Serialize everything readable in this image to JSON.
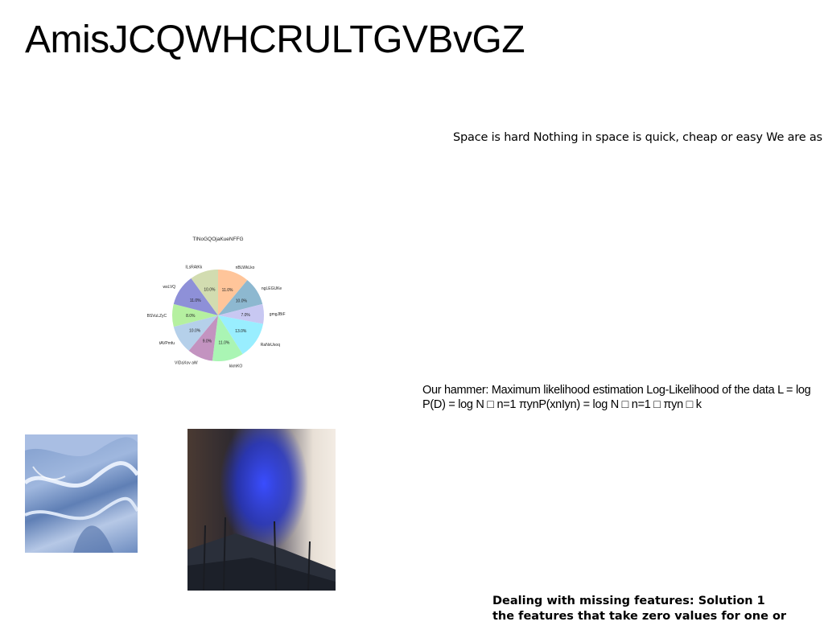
{
  "page": {
    "title": "AmisJCQWHCRULTGVBvGZ"
  },
  "texts": {
    "space": "Space is hard Nothing in space is quick, cheap or easy We are as",
    "hammer": "Our hammer: Maximum likelihood estimation Log-Likelihood of the data L = log P(D) = log N □ n=1 πynP(xnIyn) = log N □ n=1 □ πyn □ k",
    "missing_line1": "Dealing with missing features: Solution 1",
    "missing_line2": "the features that take zero values for one or"
  },
  "images": {
    "snow": "snow-dunes-photo",
    "fire": "blue-smoke-fire-photo"
  },
  "chart_data": {
    "type": "pie",
    "title": "TlNoGQOjaKueNFFG",
    "categories": [
      "nBLWkLko",
      "ngLEGUKe",
      "gmgJBiF",
      "RaNxUsoq",
      "kkmKO",
      "VIDaXov aW",
      "tAVPmfu",
      "BSVuLZyC",
      "wsLVQ",
      "ILsRAtKk"
    ],
    "values": [
      11.0,
      10.0,
      7.0,
      13.0,
      11.0,
      9.0,
      10.0,
      8.0,
      11.0,
      10.0
    ],
    "labels": [
      "11.0%",
      "10.0%",
      "7.0%",
      "13.0%",
      "11.0%",
      "9.0%",
      "10.0%",
      "8.0%",
      "11.0%",
      "10.0%"
    ],
    "colors": [
      "#ffc59a",
      "#8db8d0",
      "#c8c8f2",
      "#99eeff",
      "#aaf5b4",
      "#c393c0",
      "#b5d0ea",
      "#b5f0a0",
      "#8e90d8",
      "#d2dcb0"
    ],
    "start_angle_deg": 90,
    "direction": "clockwise"
  }
}
